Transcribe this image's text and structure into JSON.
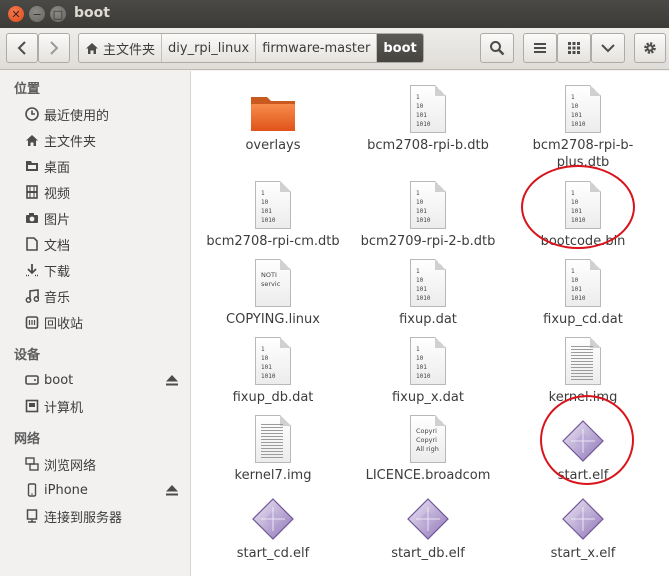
{
  "window": {
    "title": "boot"
  },
  "toolbar": {
    "breadcrumbs": [
      "主文件夹",
      "diy_rpi_linux",
      "firmware-master",
      "boot"
    ]
  },
  "sidebar": {
    "sections": [
      {
        "title": "位置",
        "items": [
          {
            "label": "最近使用的",
            "icon": "clock-icon"
          },
          {
            "label": "主文件夹",
            "icon": "home-icon"
          },
          {
            "label": "桌面",
            "icon": "desktop-folder-icon"
          },
          {
            "label": "视频",
            "icon": "video-icon"
          },
          {
            "label": "图片",
            "icon": "camera-icon"
          },
          {
            "label": "文档",
            "icon": "document-icon"
          },
          {
            "label": "下载",
            "icon": "download-icon"
          },
          {
            "label": "音乐",
            "icon": "music-icon"
          },
          {
            "label": "回收站",
            "icon": "trash-icon"
          }
        ]
      },
      {
        "title": "设备",
        "items": [
          {
            "label": "boot",
            "icon": "drive-icon"
          },
          {
            "label": "计算机",
            "icon": "computer-icon"
          }
        ]
      },
      {
        "title": "网络",
        "items": [
          {
            "label": "浏览网络",
            "icon": "network-icon"
          },
          {
            "label": "iPhone",
            "icon": "phone-icon"
          },
          {
            "label": "连接到服务器",
            "icon": "server-icon"
          }
        ]
      }
    ]
  },
  "files": [
    {
      "name": "overlays",
      "type": "folder"
    },
    {
      "name": "bcm2708-rpi-b.dtb",
      "type": "binary",
      "preview": [
        "1",
        "10",
        "101",
        "1010"
      ]
    },
    {
      "name": "bcm2708-rpi-b-plus.dtb",
      "type": "binary",
      "preview": [
        "1",
        "10",
        "101",
        "1010"
      ]
    },
    {
      "name": "bcm2708-rpi-cm.dtb",
      "type": "binary",
      "preview": [
        "1",
        "10",
        "101",
        "1010"
      ]
    },
    {
      "name": "bcm2709-rpi-2-b.dtb",
      "type": "binary",
      "preview": [
        "1",
        "10",
        "101",
        "1010"
      ]
    },
    {
      "name": "bootcode.bin",
      "type": "binary",
      "preview": [
        "1",
        "10",
        "101",
        "1010"
      ]
    },
    {
      "name": "COPYING.linux",
      "type": "text",
      "preview": [
        "NOTI",
        "servic"
      ]
    },
    {
      "name": "fixup.dat",
      "type": "binary",
      "preview": [
        "1",
        "10",
        "101",
        "1010"
      ]
    },
    {
      "name": "fixup_cd.dat",
      "type": "binary",
      "preview": [
        "1",
        "10",
        "101",
        "1010"
      ]
    },
    {
      "name": "fixup_db.dat",
      "type": "binary",
      "preview": [
        "1",
        "10",
        "101",
        "1010"
      ]
    },
    {
      "name": "fixup_x.dat",
      "type": "binary",
      "preview": [
        "1",
        "10",
        "101",
        "1010"
      ]
    },
    {
      "name": "kernel.img",
      "type": "lines"
    },
    {
      "name": "kernel7.img",
      "type": "lines"
    },
    {
      "name": "LICENCE.broadcom",
      "type": "text",
      "preview": [
        "Copyri",
        "Copyri",
        "All righ"
      ]
    },
    {
      "name": "start.elf",
      "type": "elf"
    },
    {
      "name": "start_cd.elf",
      "type": "elf"
    },
    {
      "name": "start_db.elf",
      "type": "elf"
    },
    {
      "name": "start_x.elf",
      "type": "elf"
    }
  ],
  "colors": {
    "annotation": "#d8141c",
    "folder": "#f37329",
    "accent_close": "#df4a16"
  }
}
